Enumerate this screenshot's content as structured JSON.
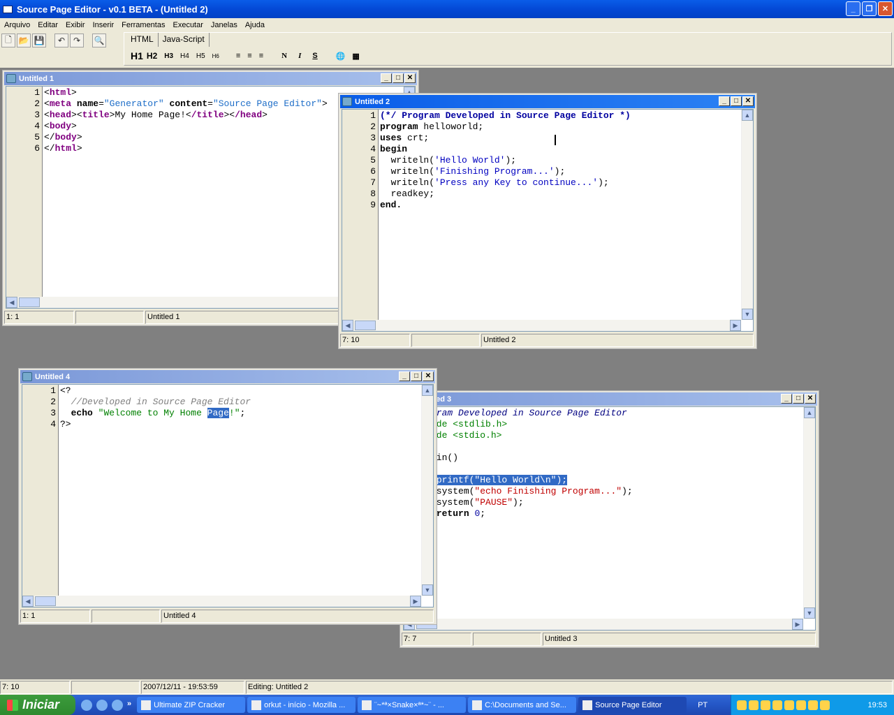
{
  "app": {
    "title": "Source Page Editor - v0.1 BETA - (Untitled 2)"
  },
  "menu": [
    "Arquivo",
    "Editar",
    "Exibir",
    "Inserir",
    "Ferramentas",
    "Executar",
    "Janelas",
    "Ajuda"
  ],
  "toolbar": {
    "buttons": [
      "new-icon",
      "open-icon",
      "save-icon",
      "undo-icon",
      "redo-icon",
      "preview-icon"
    ]
  },
  "htmlbar": {
    "tabs": [
      "HTML",
      "Java-Script"
    ],
    "active_tab": "HTML",
    "headings": [
      "H1",
      "H2",
      "H3",
      "H4",
      "H5",
      "H6"
    ],
    "format": [
      "N",
      "I",
      "S"
    ]
  },
  "windows": [
    {
      "id": "untitled1",
      "title": "Untitled 1",
      "active": false,
      "status": [
        "1: 1",
        "",
        "Untitled 1"
      ],
      "lines": [
        [
          [
            "<",
            "tag0"
          ],
          [
            "html",
            "tag"
          ],
          [
            ">",
            "tag0"
          ]
        ],
        [
          [
            "<",
            "tag0"
          ],
          [
            "meta",
            "tag"
          ],
          [
            " "
          ],
          [
            "name",
            "k"
          ],
          [
            "="
          ],
          [
            "\"Generator\"",
            "attr"
          ],
          [
            " "
          ],
          [
            "content",
            "k"
          ],
          [
            "="
          ],
          [
            "\"Source Page Editor\"",
            "attr"
          ],
          [
            ">"
          ]
        ],
        [
          [
            "<"
          ],
          [
            "head",
            "tag"
          ],
          [
            "><"
          ],
          [
            "title",
            "tag"
          ],
          [
            ">My Home Page!<"
          ],
          [
            "/title",
            "tag"
          ],
          [
            "><"
          ],
          [
            "/head",
            "tag"
          ],
          [
            ">"
          ]
        ],
        [
          [
            "<"
          ],
          [
            "body",
            "tag"
          ],
          [
            ">"
          ]
        ],
        [
          [
            "</"
          ],
          [
            "body",
            "tag"
          ],
          [
            ">"
          ]
        ],
        [
          [
            "</"
          ],
          [
            "html",
            "tag"
          ],
          [
            ">"
          ]
        ]
      ]
    },
    {
      "id": "untitled2",
      "title": "Untitled 2",
      "active": true,
      "status": [
        "7: 10",
        "",
        "Untitled 2"
      ],
      "lines": [
        [
          [
            "(*/ Program Developed in Source Page Editor *)",
            "pcom"
          ]
        ],
        [
          [
            "program",
            "k"
          ],
          [
            " helloworld;"
          ]
        ],
        [
          [
            "uses",
            "k"
          ],
          [
            " crt;"
          ]
        ],
        [
          [
            "begin",
            "k"
          ]
        ],
        [
          [
            "  writeln("
          ],
          [
            "'Hello World'",
            "pstr"
          ],
          [
            ");"
          ]
        ],
        [
          [
            "  writeln("
          ],
          [
            "'Finishing Program...'",
            "pstr"
          ],
          [
            ");"
          ]
        ],
        [
          [
            "  writeln("
          ],
          [
            "'Press any Key to continue...'",
            "pstr"
          ],
          [
            ");"
          ]
        ],
        [
          [
            "  readkey;"
          ]
        ],
        [
          [
            "end.",
            "k"
          ]
        ]
      ]
    },
    {
      "id": "untitled3",
      "title": "Untitled 3",
      "active": false,
      "status": [
        "7: 7",
        "",
        "Untitled 3"
      ],
      "lines": [
        [
          [
            "//Program Developed in Source Page Editor",
            "ccom"
          ]
        ],
        [
          [
            "#include <stdlib.h>",
            "cpre"
          ]
        ],
        [
          [
            "#include <stdio.h>",
            "cpre"
          ]
        ],
        [
          [
            ""
          ]
        ],
        [
          [
            "int",
            "k"
          ],
          [
            " main()"
          ]
        ],
        [
          [
            "{"
          ]
        ],
        [
          [
            "      "
          ],
          [
            "printf(\"Hello World\\n\");",
            "sel"
          ]
        ],
        [
          [
            "      system("
          ],
          [
            "\"echo Finishing Program...\"",
            "cstr"
          ],
          [
            ");"
          ]
        ],
        [
          [
            "      system("
          ],
          [
            "\"PAUSE\"",
            "cstr"
          ],
          [
            ");"
          ]
        ],
        [
          [
            "      "
          ],
          [
            "return",
            "k"
          ],
          [
            " "
          ],
          [
            "0",
            "num"
          ],
          [
            ";"
          ]
        ],
        [
          [
            "}"
          ]
        ]
      ]
    },
    {
      "id": "untitled4",
      "title": "Untitled 4",
      "active": false,
      "status": [
        "1: 1",
        "",
        "Untitled 4"
      ],
      "lines": [
        [
          [
            "<?"
          ]
        ],
        [
          [
            "  "
          ],
          [
            "//Developed in Source Page Editor",
            "phpcom"
          ]
        ],
        [
          [
            "  "
          ],
          [
            "echo",
            "k"
          ],
          [
            " "
          ],
          [
            "\"Welcome to My Home ",
            "phpstr"
          ],
          [
            "Page",
            "sel"
          ],
          [
            "!\"",
            "phpstr"
          ],
          [
            ";"
          ]
        ],
        [
          [
            "?>"
          ]
        ]
      ]
    }
  ],
  "statusbar": [
    "7: 10",
    "",
    "2007/12/11 - 19:53:59",
    "Editing: Untitled 2"
  ],
  "taskbar": {
    "start": "Iniciar",
    "tasks": [
      "Ultimate ZIP Cracker",
      "orkut - início - Mozilla ...",
      "¨~*ª×Snake×ª*~¨ - ...",
      "C:\\Documents and Se...",
      "Source Page Editor"
    ],
    "active_task": "Source Page Editor",
    "language": "PT",
    "clock": "19:53"
  }
}
